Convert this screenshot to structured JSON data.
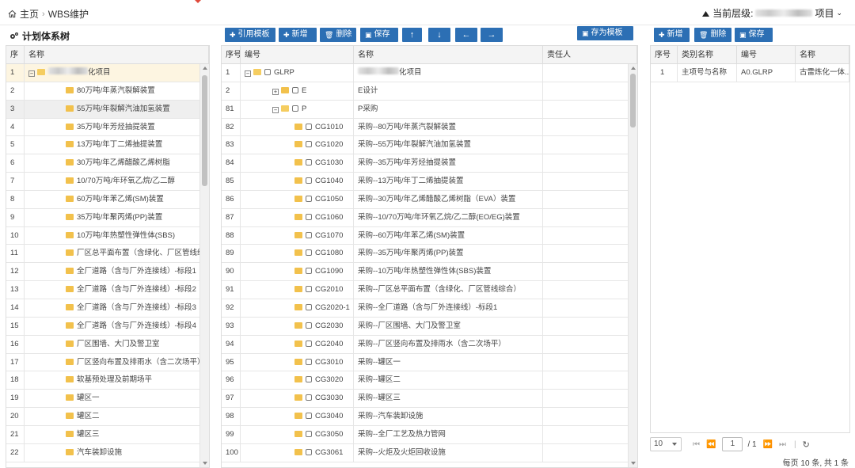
{
  "breadcrumb": {
    "home": "主页",
    "current": "WBS维护"
  },
  "level": {
    "label": "当前层级:",
    "suffix": "项目"
  },
  "left": {
    "title": "计划体系树",
    "headers": [
      "序",
      "名称"
    ],
    "rows": [
      {
        "n": "1",
        "name": "化项目"
      },
      {
        "n": "2",
        "name": "80万吨/年蒸汽裂解装置"
      },
      {
        "n": "3",
        "name": "55万吨/年裂解汽油加氢装置"
      },
      {
        "n": "4",
        "name": "35万吨/年芳烃抽提装置"
      },
      {
        "n": "5",
        "name": "13万吨/年丁二烯抽提装置"
      },
      {
        "n": "6",
        "name": "30万吨/年乙烯醋酸乙烯树脂"
      },
      {
        "n": "7",
        "name": "10/70万吨/年环氧乙烷/乙二醇"
      },
      {
        "n": "8",
        "name": "60万吨/年苯乙烯(SM)装置"
      },
      {
        "n": "9",
        "name": "35万吨/年聚丙烯(PP)装置"
      },
      {
        "n": "10",
        "name": "10万吨/年热塑性弹性体(SBS)"
      },
      {
        "n": "11",
        "name": "厂区总平面布置（含绿化、厂区管线综合"
      },
      {
        "n": "12",
        "name": "全厂道路（含与厂外连接线）-标段1"
      },
      {
        "n": "13",
        "name": "全厂道路（含与厂外连接线）-标段2"
      },
      {
        "n": "14",
        "name": "全厂道路（含与厂外连接线）-标段3"
      },
      {
        "n": "15",
        "name": "全厂道路（含与厂外连接线）-标段4"
      },
      {
        "n": "16",
        "name": "厂区围墙、大门及警卫室"
      },
      {
        "n": "17",
        "name": "厂区竖向布置及排雨水（含二次场平）"
      },
      {
        "n": "18",
        "name": "软基预处理及前期场平"
      },
      {
        "n": "19",
        "name": "罐区一"
      },
      {
        "n": "20",
        "name": "罐区二"
      },
      {
        "n": "21",
        "name": "罐区三"
      },
      {
        "n": "22",
        "name": "汽车装卸设施"
      }
    ]
  },
  "mid": {
    "buttons": {
      "ref": "引用模板",
      "add": "新增",
      "del": "删除",
      "save": "保存",
      "saveas": "存为模板"
    },
    "headers": [
      "序号",
      "编号",
      "名称",
      "责任人"
    ],
    "rows": [
      {
        "n": "1",
        "code": "GLRP",
        "name": "化项目"
      },
      {
        "n": "2",
        "code": "E",
        "name": "E设计"
      },
      {
        "n": "81",
        "code": "P",
        "name": "P采购"
      },
      {
        "n": "82",
        "code": "CG1010",
        "name": "采购--80万吨/年蒸汽裂解装置"
      },
      {
        "n": "83",
        "code": "CG1020",
        "name": "采购--55万吨/年裂解汽油加氢装置"
      },
      {
        "n": "84",
        "code": "CG1030",
        "name": "采购--35万吨/年芳烃抽提装置"
      },
      {
        "n": "85",
        "code": "CG1040",
        "name": "采购--13万吨/年丁二烯抽提装置"
      },
      {
        "n": "86",
        "code": "CG1050",
        "name": "采购--30万吨/年乙烯醋酸乙烯树脂（EVA）装置"
      },
      {
        "n": "87",
        "code": "CG1060",
        "name": "采购--10/70万吨/年环氧乙烷/乙二醇(EO/EG)装置"
      },
      {
        "n": "88",
        "code": "CG1070",
        "name": "采购--60万吨/年苯乙烯(SM)装置"
      },
      {
        "n": "89",
        "code": "CG1080",
        "name": "采购--35万吨/年聚丙烯(PP)装置"
      },
      {
        "n": "90",
        "code": "CG1090",
        "name": "采购--10万吨/年热塑性弹性体(SBS)装置"
      },
      {
        "n": "91",
        "code": "CG2010",
        "name": "采购--厂区总平面布置（含绿化、厂区管线综合）"
      },
      {
        "n": "92",
        "code": "CG2020-1",
        "name": "采购--全厂道路（含与厂外连接线）-标段1"
      },
      {
        "n": "93",
        "code": "CG2030",
        "name": "采购--厂区围墙、大门及警卫室"
      },
      {
        "n": "94",
        "code": "CG2040",
        "name": "采购--厂区竖向布置及排雨水（含二次场平）"
      },
      {
        "n": "95",
        "code": "CG3010",
        "name": "采购--罐区一"
      },
      {
        "n": "96",
        "code": "CG3020",
        "name": "采购--罐区二"
      },
      {
        "n": "97",
        "code": "CG3030",
        "name": "采购--罐区三"
      },
      {
        "n": "98",
        "code": "CG3040",
        "name": "采购--汽车装卸设施"
      },
      {
        "n": "99",
        "code": "CG3050",
        "name": "采购--全厂工艺及热力管网"
      },
      {
        "n": "100",
        "code": "CG3061",
        "name": "采购--火炬及火炬回收设施"
      }
    ]
  },
  "right": {
    "buttons": {
      "add": "新增",
      "del": "删除",
      "save": "保存"
    },
    "headers": [
      "序号",
      "类别名称",
      "编号",
      "名称"
    ],
    "rows": [
      {
        "n": "1",
        "cat": "主项号与名称",
        "code": "A0.GLRP",
        "name": "古雷炼化一体..."
      }
    ],
    "pager": {
      "size": "10",
      "page": "1",
      "total": "/ 1",
      "info": "每页 10 条, 共 1 条"
    }
  }
}
